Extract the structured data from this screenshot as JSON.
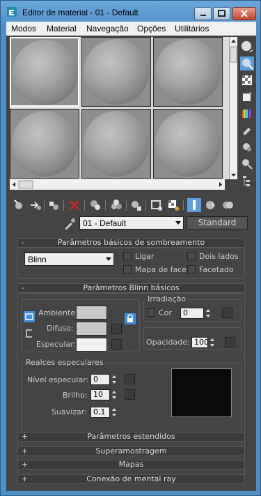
{
  "window": {
    "title": "Editor de material - 01 - Default"
  },
  "menu": [
    "Modos",
    "Material",
    "Navegação",
    "Opções",
    "Utilitários"
  ],
  "material": {
    "name": "01 - Default",
    "type": "Standard"
  },
  "shading_params": {
    "header": "Parâmetros básicos de sombreamento",
    "shader": "Blinn",
    "options": {
      "wire": "Ligar",
      "two_sided": "Dois lados",
      "face_map": "Mapa de face",
      "faceted": "Facetado"
    }
  },
  "blinn_params": {
    "header": "Parâmetros Blinn básicos",
    "ambient": "Ambiente:",
    "diffuse": "Difuso:",
    "specular": "Especular:",
    "self_illum": {
      "title": "Irradiação",
      "color_label": "Cor",
      "value": "0"
    },
    "opacity": {
      "label": "Opacidade:",
      "value": "100"
    },
    "highlights": {
      "title": "Realces especulares",
      "level_label": "Nível especular:",
      "level_value": "0",
      "gloss_label": "Brilho:",
      "gloss_value": "10",
      "soften_label": "Suavizar:",
      "soften_value": "0,1"
    }
  },
  "rollouts": [
    "Parâmetros estendidos",
    "Superamostragem",
    "Mapas",
    "Conexão de mental ray"
  ],
  "colors": {
    "bg": "#444444",
    "window_blue": "#4c8fc9",
    "swatch_gray": "#c8c8c8",
    "swatch_light": "#f2f2f2"
  }
}
